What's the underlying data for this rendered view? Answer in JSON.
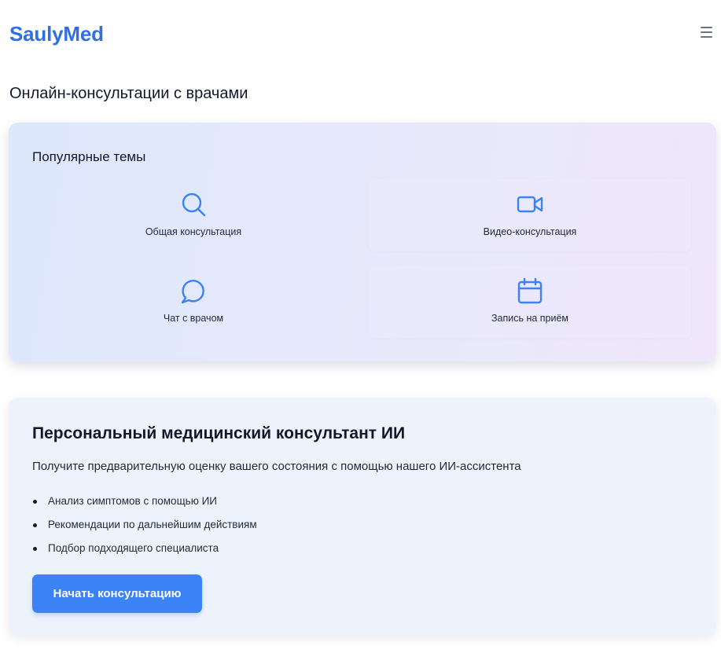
{
  "header": {
    "logo": "SaulyMed",
    "menu_icon": "hamburger-menu-icon"
  },
  "page_title": "Онлайн-консультации с врачами",
  "topics": {
    "title": "Популярные темы",
    "items": [
      {
        "label": "Общая консультация",
        "icon": "search-icon"
      },
      {
        "label": "Видео-консультация",
        "icon": "video-camera-icon"
      },
      {
        "label": "Чат с врачом",
        "icon": "chat-bubble-icon"
      },
      {
        "label": "Запись на приём",
        "icon": "calendar-icon"
      }
    ]
  },
  "ai_consultant": {
    "title": "Персональный медицинский консультант ИИ",
    "description": "Получите предварительную оценку вашего состояния с помощью нашего ИИ-ассистента",
    "features": [
      "Анализ симптомов с помощью ИИ",
      "Рекомендации по дальнейшим действиям",
      "Подбор подходящего специалиста"
    ],
    "button_label": "Начать консультацию"
  },
  "colors": {
    "brand": "#2f6fe0",
    "accent": "#3b82f6",
    "icon": "#3b82f6",
    "card_gradient_start": "#dde8fc",
    "card_gradient_end": "#efe6fb",
    "ai_card_bg": "#edf3fd"
  }
}
